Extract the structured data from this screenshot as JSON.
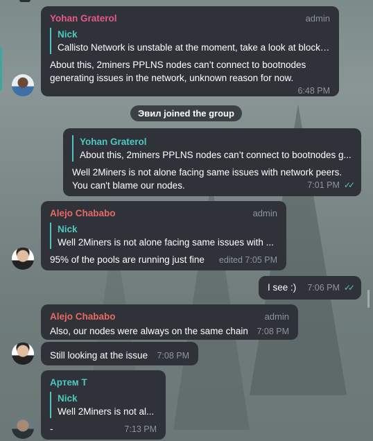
{
  "service_message": "Эвил joined the group",
  "messages": [
    {
      "sender": "Yohan Graterol",
      "role": "admin",
      "reply_name": "Nick",
      "reply_text": "Callisto Network is unstable at the moment, take a look at block…",
      "text": "About this, 2miners PPLNS nodes can’t connect to bootnodes generating issues in the network, unknown reason for now.",
      "time": "6:48 PM"
    },
    {
      "reply_name": "Yohan Graterol",
      "reply_text": "About this, 2miners PPLNS nodes can’t connect to bootnodes g...",
      "text": "Well 2Miners is not alone facing same issues with network peers. You can't blame our nodes.",
      "time": "7:01 PM"
    },
    {
      "sender": "Alejo Chababo",
      "role": "admin",
      "reply_name": "Nick",
      "reply_text": "Well 2Miners is not alone facing same issues with ...",
      "text": "95% of the pools are running just fine",
      "time": "edited 7:05 PM"
    },
    {
      "text": "I see :)",
      "time": "7:06 PM"
    },
    {
      "sender": "Alejo Chababo",
      "role": "admin",
      "text": "Also, our nodes were always on the same chain",
      "time": "7:08 PM"
    },
    {
      "text": "Still looking at the issue",
      "time": "7:08 PM"
    },
    {
      "sender": "Артем Т",
      "reply_name": "Nick",
      "reply_text": "Well 2Miners is not al...",
      "text": "-",
      "time": "7:13 PM"
    }
  ]
}
